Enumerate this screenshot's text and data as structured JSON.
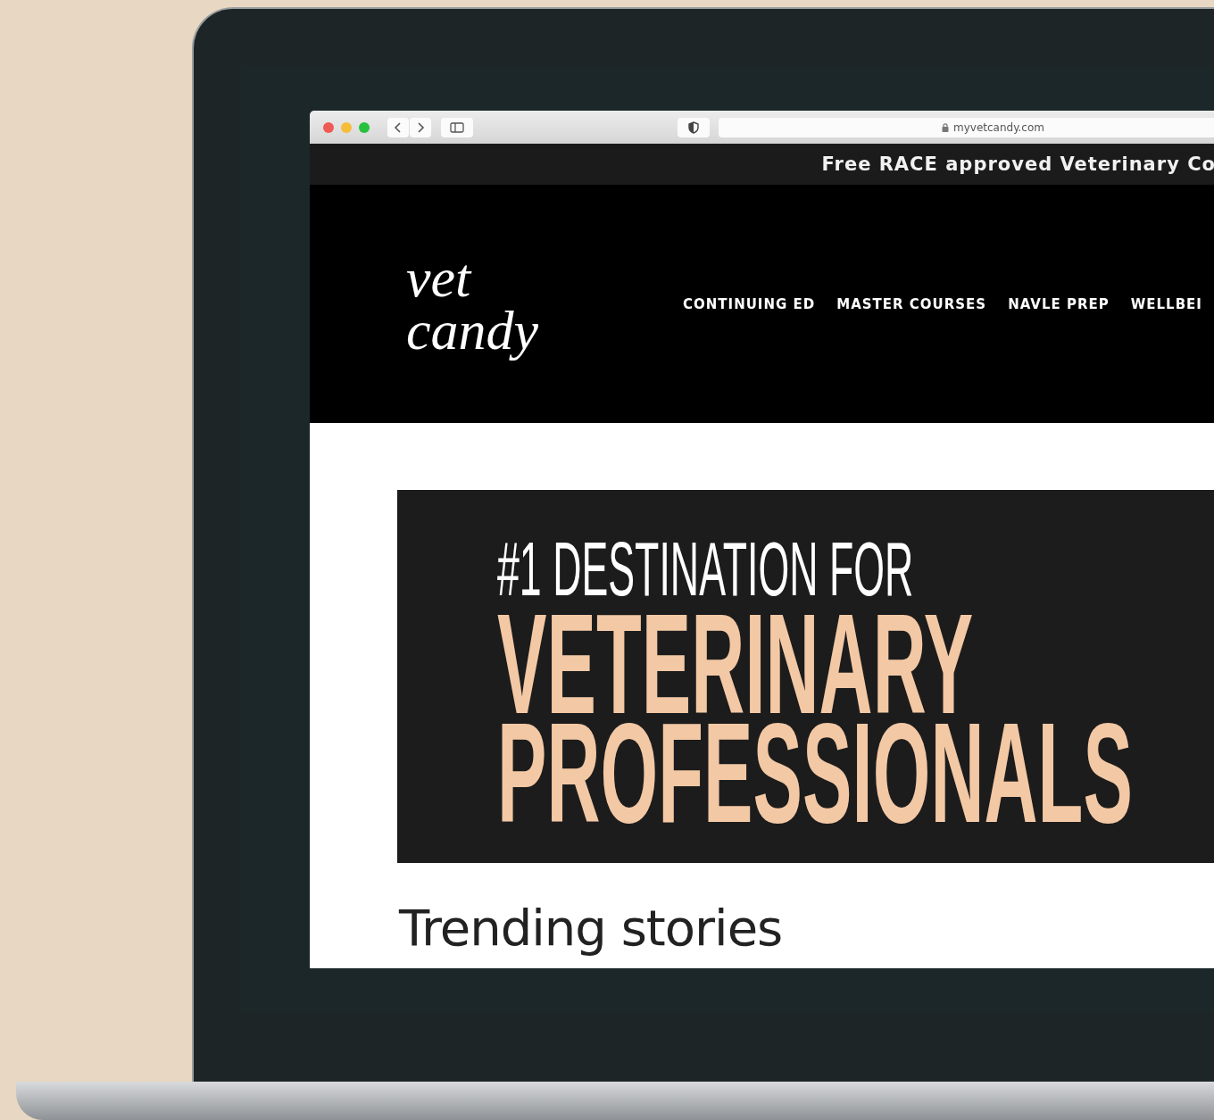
{
  "browser": {
    "url": "myvetcandy.com"
  },
  "announcement": "Free RACE approved Veterinary Co",
  "header": {
    "logo": "vet candy",
    "nav": [
      "CONTINUING ED",
      "MASTER COURSES",
      "NAVLE PREP",
      "WELLBEI"
    ]
  },
  "hero": {
    "kicker": "#1 DESTINATION FOR",
    "headline": [
      "VETERINARY",
      "PROFESSIONALS"
    ]
  },
  "section_title": "Trending stories"
}
